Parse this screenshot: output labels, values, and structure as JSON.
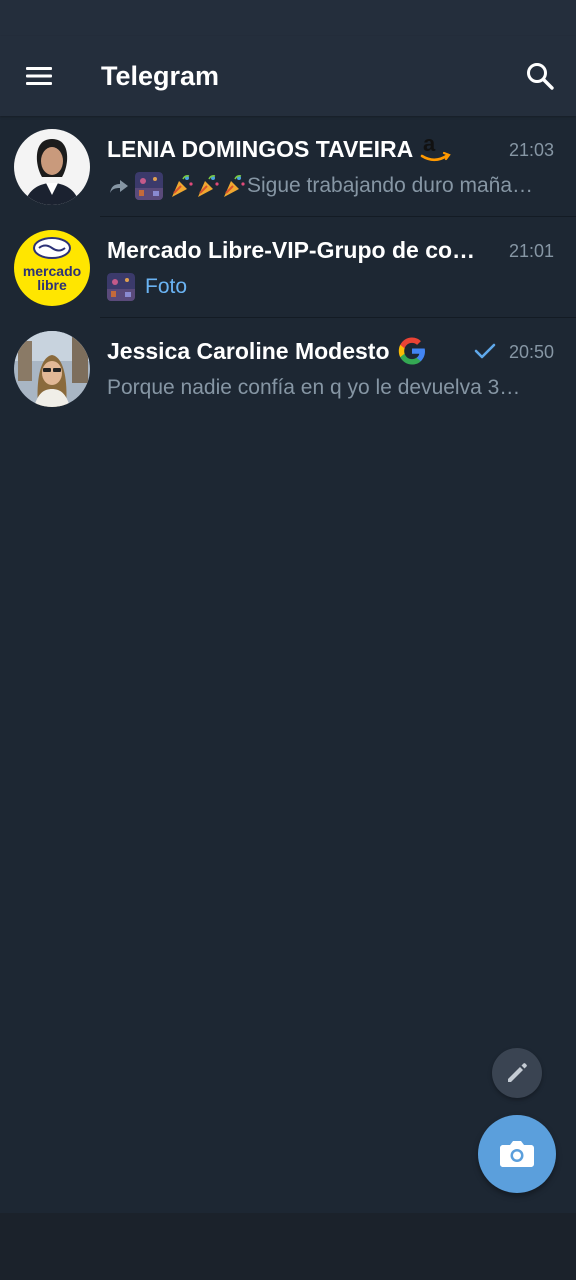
{
  "app": {
    "title": "Telegram"
  },
  "chats": [
    {
      "name": "LENIA DOMINGOS TAVEIRA",
      "time": "21:03",
      "preview": "Sigue trabajando duro maña…",
      "forwarded": true,
      "badge_icon": "amazon-logo-icon"
    },
    {
      "name": "Mercado Libre-VIP-Grupo de com…",
      "time": "21:01",
      "preview": "Foto",
      "avatar_text_top": "mercado",
      "avatar_text_bottom": "libre"
    },
    {
      "name": "Jessica Caroline Modesto",
      "time": "20:50",
      "preview": "Porque nadie confía en q yo le devuelva 3…",
      "sent_check": true,
      "badge_icon": "google-logo-icon"
    }
  ],
  "colors": {
    "background": "#1d2733",
    "header": "#242e3c",
    "accent": "#5b9fdc",
    "link": "#6ab3f3",
    "muted": "#8696a4"
  }
}
